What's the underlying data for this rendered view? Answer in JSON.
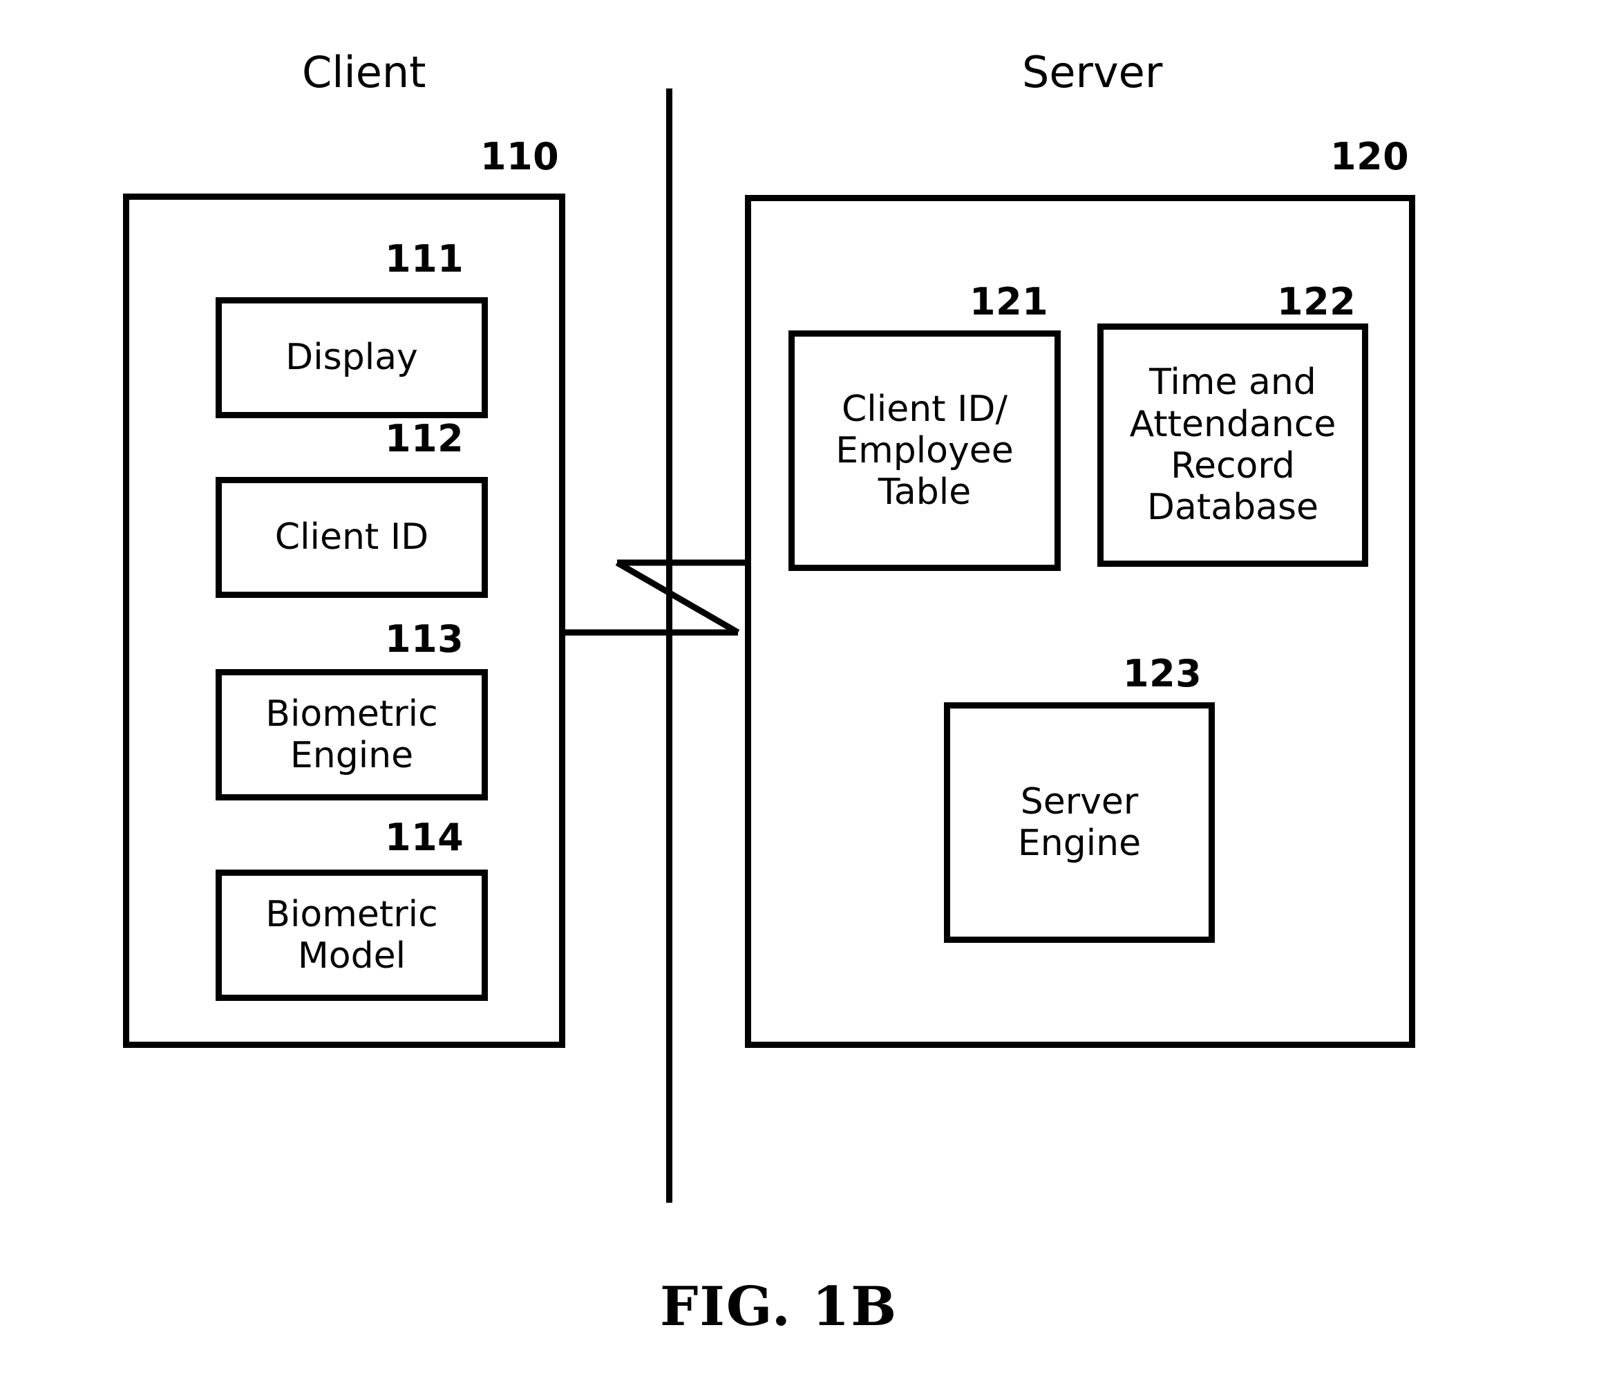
{
  "figure": {
    "caption": "FIG. 1B",
    "type": "patent-block-diagram"
  },
  "sections": {
    "client": {
      "title": "Client",
      "ref": "110",
      "modules": [
        {
          "ref": "111",
          "label": "Display"
        },
        {
          "ref": "112",
          "label": "Client ID"
        },
        {
          "ref": "113",
          "label": "Biometric\nEngine"
        },
        {
          "ref": "114",
          "label": "Biometric\nModel"
        }
      ]
    },
    "server": {
      "title": "Server",
      "ref": "120",
      "modules": [
        {
          "ref": "121",
          "label": "Client ID/\nEmployee\nTable"
        },
        {
          "ref": "122",
          "label": "Time and\nAttendance\nRecord\nDatabase"
        },
        {
          "ref": "123",
          "label": "Server\nEngine"
        }
      ]
    }
  },
  "connector": {
    "name": "network-break-link",
    "description": "zigzag break line linking client and server"
  },
  "colors": {
    "stroke": "#000000",
    "background": "#ffffff"
  }
}
